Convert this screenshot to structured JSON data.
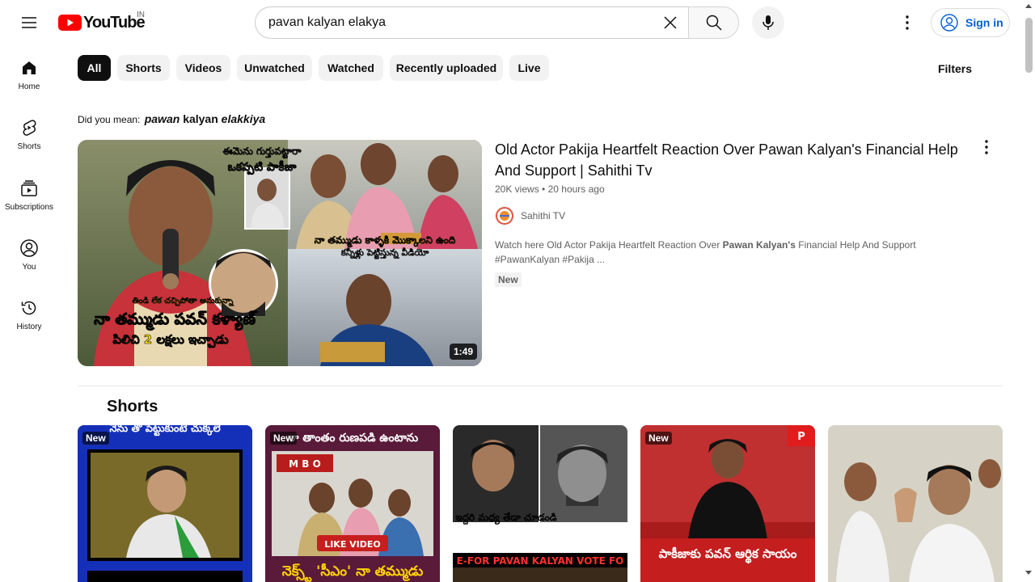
{
  "header": {
    "logo_text": "YouTube",
    "country_code": "IN",
    "search_value": "pavan kalyan elakya",
    "search_placeholder": "Search",
    "signin_label": "Sign in"
  },
  "sidebar": {
    "items": [
      {
        "label": "Home",
        "icon": "home-icon"
      },
      {
        "label": "Shorts",
        "icon": "shorts-icon"
      },
      {
        "label": "Subscriptions",
        "icon": "subscriptions-icon"
      },
      {
        "label": "You",
        "icon": "you-icon"
      },
      {
        "label": "History",
        "icon": "history-icon"
      }
    ]
  },
  "chips": [
    "All",
    "Shorts",
    "Videos",
    "Unwatched",
    "Watched",
    "Recently uploaded",
    "Live"
  ],
  "filters_label": "Filters",
  "did_you_mean": {
    "prefix": "Did you mean:",
    "word1": "pawan",
    "word2": "kalyan",
    "word3": "elakkiya"
  },
  "video": {
    "title": "Old Actor Pakija Heartfelt Reaction Over Pawan Kalyan's Financial Help And Support | Sahithi Tv",
    "views": "20K views",
    "age": "20 hours ago",
    "channel": "Sahithi TV",
    "desc_before": "Watch here Old Actor Pakija Heartfelt Reaction Over ",
    "desc_bold": "Pawan Kalyan's",
    "desc_after": " Financial Help And Support #PawanKalyan #Pakija ...",
    "badge": "New",
    "duration": "1:49",
    "thumb_caption_top": "ఈమెను గుర్తుపట్టారా ఒకప్పటి పాకీజా",
    "thumb_caption_mid": "నా తమ్ముడు కాళ్ళకి మొక్కాలని ఉంది",
    "thumb_caption_mid2": "కన్నీళ్లు పెట్టిస్తున్న వీడియో",
    "thumb_caption_small": "తిండి లేక చచ్చిపోతా అనుకున్నా",
    "thumb_caption_big": "నా తమ్ముడు పవన్ కళ్యాణ్",
    "thumb_caption_bottom": "పిలిచి 2 లక్షలు ఇచ్చాడు"
  },
  "shorts": {
    "title": "Shorts",
    "items": [
      {
        "new": "New",
        "top_text": "నేను తో పెట్టుకుంటే చుక్కలే",
        "bottom_text": ""
      },
      {
        "new": "New",
        "top_text": "నా తాంతం రుణపడి ఉంటాను",
        "bottom_text": "నెక్స్ట్ 'సీఎం' నా తమ్ముడు",
        "like_label": "LIKE VIDEO"
      },
      {
        "new": "",
        "top_text": "ఇద్దరి మధ్య తేడా చూడండి",
        "bottom_text": "E-FOR PAVAN KALYAN VOTE FO"
      },
      {
        "new": "New",
        "top_text": "",
        "bottom_text": "పాకీజాకు పవన్ ఆర్థిక సాయం"
      },
      {
        "new": "",
        "top_text": "",
        "bottom_text": ""
      }
    ]
  }
}
